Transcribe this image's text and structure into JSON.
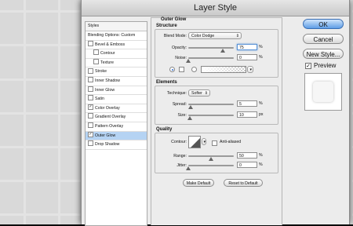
{
  "window": {
    "title": "Layer Style"
  },
  "styles_panel": {
    "header": "Styles",
    "items": [
      {
        "label": "Blending Options: Custom",
        "checkbox": false,
        "checked": false,
        "indent": false,
        "selected": false
      },
      {
        "label": "Bevel & Emboss",
        "checkbox": true,
        "checked": false,
        "indent": false,
        "selected": false
      },
      {
        "label": "Contour",
        "checkbox": true,
        "checked": false,
        "indent": true,
        "selected": false
      },
      {
        "label": "Texture",
        "checkbox": true,
        "checked": false,
        "indent": true,
        "selected": false
      },
      {
        "label": "Stroke",
        "checkbox": true,
        "checked": false,
        "indent": false,
        "selected": false
      },
      {
        "label": "Inner Shadow",
        "checkbox": true,
        "checked": false,
        "indent": false,
        "selected": false
      },
      {
        "label": "Inner Glow",
        "checkbox": true,
        "checked": false,
        "indent": false,
        "selected": false
      },
      {
        "label": "Satin",
        "checkbox": true,
        "checked": false,
        "indent": false,
        "selected": false
      },
      {
        "label": "Color Overlay",
        "checkbox": true,
        "checked": true,
        "indent": false,
        "selected": false
      },
      {
        "label": "Gradient Overlay",
        "checkbox": true,
        "checked": false,
        "indent": false,
        "selected": false
      },
      {
        "label": "Pattern Overlay",
        "checkbox": true,
        "checked": false,
        "indent": false,
        "selected": false
      },
      {
        "label": "Outer Glow",
        "checkbox": true,
        "checked": true,
        "indent": false,
        "selected": true
      },
      {
        "label": "Drop Shadow",
        "checkbox": true,
        "checked": false,
        "indent": false,
        "selected": false
      }
    ]
  },
  "outer_glow": {
    "title": "Outer Glow",
    "structure": {
      "title": "Structure",
      "blend_mode_label": "Blend Mode:",
      "blend_mode_value": "Color Dodge",
      "opacity_label": "Opacity:",
      "opacity_value": "75",
      "opacity_fraction": 0.75,
      "noise_label": "Noise:",
      "noise_value": "0",
      "noise_fraction": 0.0,
      "unit": "%"
    },
    "elements": {
      "title": "Elements",
      "technique_label": "Technique:",
      "technique_value": "Softer",
      "spread_label": "Spread:",
      "spread_value": "5",
      "spread_fraction": 0.05,
      "size_label": "Size:",
      "size_value": "10",
      "size_fraction": 0.04,
      "pct_unit": "%",
      "px_unit": "px"
    },
    "quality": {
      "title": "Quality",
      "contour_label": "Contour:",
      "anti_aliased_label": "Anti-aliased",
      "range_label": "Range:",
      "range_value": "50",
      "range_fraction": 0.5,
      "jitter_label": "Jitter:",
      "jitter_value": "0",
      "jitter_fraction": 0.0,
      "unit": "%"
    },
    "make_default_label": "Make Default",
    "reset_default_label": "Reset to Default"
  },
  "actions": {
    "ok_label": "OK",
    "cancel_label": "Cancel",
    "new_style_label": "New Style...",
    "preview_label": "Preview",
    "preview_checked": true
  },
  "colors": {
    "accent": "#5e9de6",
    "selection": "#b5d3f3",
    "canvas_background": "#0f0f10",
    "grid_lines": "#e3e3e3"
  }
}
